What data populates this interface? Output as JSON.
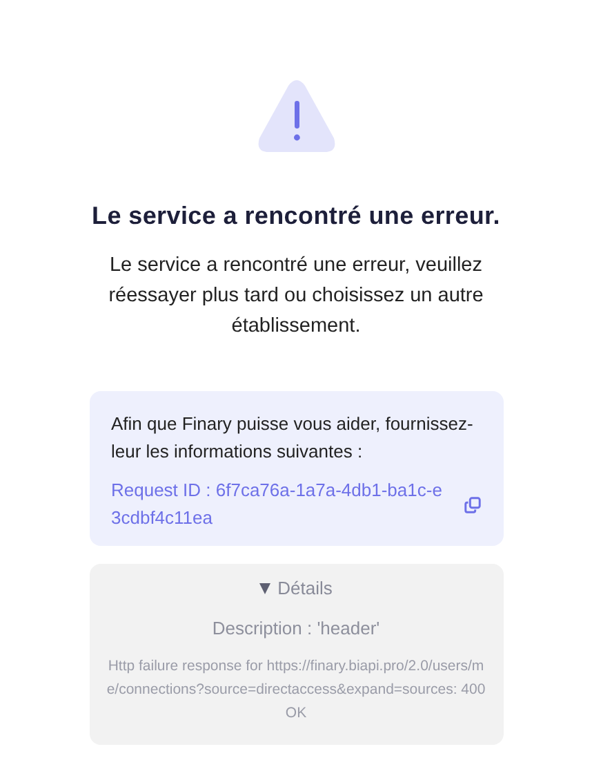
{
  "title": "Le service a rencontré une erreur.",
  "message": "Le service a rencontré une erreur, veuillez réessayer plus tard ou choisissez un autre établissement.",
  "help": {
    "text": "Afin que Finary puisse vous aider, fournissez-leur les informations suivantes :",
    "request_id": "Request ID : 6f7ca76a-1a7a-4db1-ba1c-e3cdbf4c11ea"
  },
  "details": {
    "label": "Détails",
    "expanded": true,
    "description": "Description : 'header'",
    "error": "Http failure response for https://finary.biapi.pro/2.0/users/me/connections?source=directaccess&expand=sources: 400 OK"
  }
}
